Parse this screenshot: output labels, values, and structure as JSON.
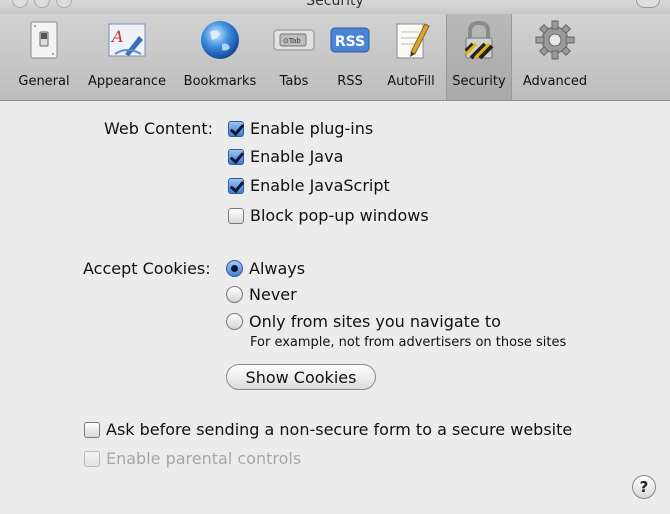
{
  "window": {
    "title": "Security"
  },
  "toolbar": {
    "items": [
      {
        "label": "General",
        "icon": "switch-icon"
      },
      {
        "label": "Appearance",
        "icon": "font-icon"
      },
      {
        "label": "Bookmarks",
        "icon": "globe-icon"
      },
      {
        "label": "Tabs",
        "icon": "tab-icon"
      },
      {
        "label": "RSS",
        "icon": "rss-icon"
      },
      {
        "label": "AutoFill",
        "icon": "pen-paper-icon"
      },
      {
        "label": "Security",
        "icon": "lock-icon",
        "selected": true
      },
      {
        "label": "Advanced",
        "icon": "gear-icon"
      }
    ],
    "tabs_icon_text": "⊙Tab",
    "rss_icon_text": "RSS"
  },
  "web_content": {
    "label": "Web Content:",
    "options": [
      {
        "label": "Enable plug-ins",
        "checked": true
      },
      {
        "label": "Enable Java",
        "checked": true
      },
      {
        "label": "Enable JavaScript",
        "checked": true
      },
      {
        "label": "Block pop-up windows",
        "checked": false
      }
    ]
  },
  "cookies": {
    "label": "Accept Cookies:",
    "options": [
      {
        "label": "Always",
        "selected": true
      },
      {
        "label": "Never",
        "selected": false
      },
      {
        "label": "Only from sites you navigate to",
        "selected": false
      }
    ],
    "hint": "For example, not from advertisers on those sites",
    "show_button": "Show Cookies"
  },
  "ask_nonsecure": {
    "label": "Ask before sending a non-secure form to a secure website",
    "checked": false
  },
  "parental": {
    "label": "Enable parental controls",
    "checked": false,
    "enabled": false
  },
  "help": {
    "label": "?"
  }
}
